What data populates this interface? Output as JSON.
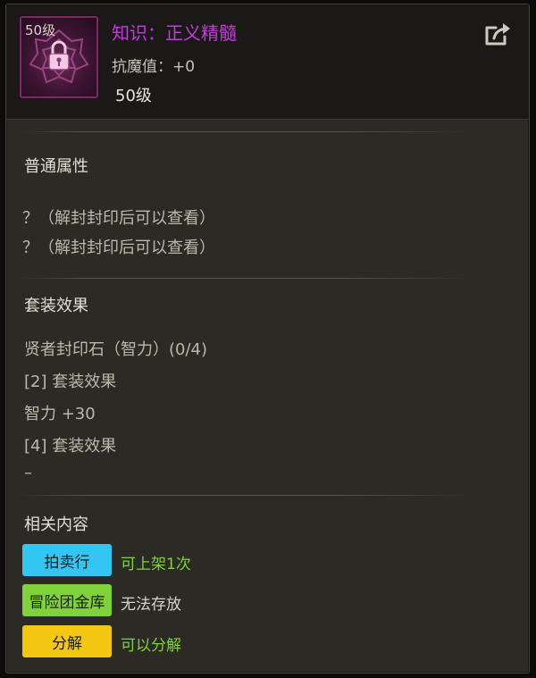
{
  "item": {
    "icon_level": "50级",
    "title": "知识：正义精髓",
    "stat": "抗魔值：+0",
    "level": "50级"
  },
  "header": {
    "share_icon": "share-export-icon"
  },
  "basic_attributes": {
    "title": "普通属性",
    "lines": [
      "？（解封封印后可以查看）",
      "？（解封封印后可以查看）"
    ]
  },
  "set_effect": {
    "title": "套装效果",
    "lines": [
      "贤者封印石（智力）(0/4)",
      "[2] 套装效果",
      "智力 +30",
      "[4] 套装效果",
      "–"
    ]
  },
  "related": {
    "title": "相关内容",
    "rows": [
      {
        "button": "拍卖行",
        "note": "可上架1次",
        "button_color": "#34c6f2",
        "note_color": "#7fd23a"
      },
      {
        "button": "冒险团金库",
        "note": "无法存放",
        "button_color": "#7fd23a",
        "note_color": "#d6d2c6"
      },
      {
        "button": "分解",
        "note": "可以分解",
        "button_color": "#f2c812",
        "note_color": "#7fd23a"
      }
    ]
  },
  "colors": {
    "title_purple": "#c03cd8",
    "panel_bg": "#2c2a25",
    "header_bg": "#1a1917"
  }
}
